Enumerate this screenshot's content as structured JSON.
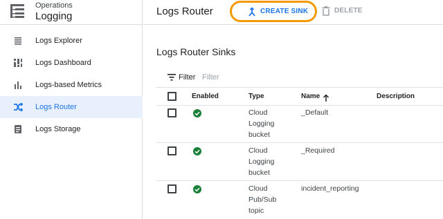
{
  "product": {
    "super_title": "Operations",
    "title": "Logging",
    "icon": "logging-product-icon"
  },
  "sidebar": {
    "items": [
      {
        "label": "Logs Explorer",
        "icon": "list-icon",
        "active": false
      },
      {
        "label": "Logs Dashboard",
        "icon": "dashboard-icon",
        "active": false
      },
      {
        "label": "Logs-based Metrics",
        "icon": "bar-chart-icon",
        "active": false
      },
      {
        "label": "Logs Router",
        "icon": "router-icon",
        "active": true
      },
      {
        "label": "Logs Storage",
        "icon": "storage-icon",
        "active": false
      }
    ]
  },
  "header": {
    "title": "Logs Router",
    "create_label": "CREATE SINK",
    "delete_label": "DELETE"
  },
  "main": {
    "section_title": "Logs Router Sinks",
    "filter": {
      "label": "Filter",
      "placeholder": "Filter"
    },
    "columns": [
      "Enabled",
      "Type",
      "Name",
      "Description"
    ],
    "sort": {
      "column": "Name",
      "direction": "ascending"
    },
    "rows": [
      {
        "enabled": true,
        "type": "Cloud Logging bucket",
        "name": "_Default",
        "description": ""
      },
      {
        "enabled": true,
        "type": "Cloud Logging bucket",
        "name": "_Required",
        "description": ""
      },
      {
        "enabled": true,
        "type": "Cloud Pub/Sub topic",
        "name": "incident_reporting",
        "description": ""
      }
    ]
  },
  "colors": {
    "accent": "#1a73e8",
    "highlight_ring": "#f29900",
    "enabled_green": "#188038",
    "active_nav_bg": "#e8f0fe"
  }
}
